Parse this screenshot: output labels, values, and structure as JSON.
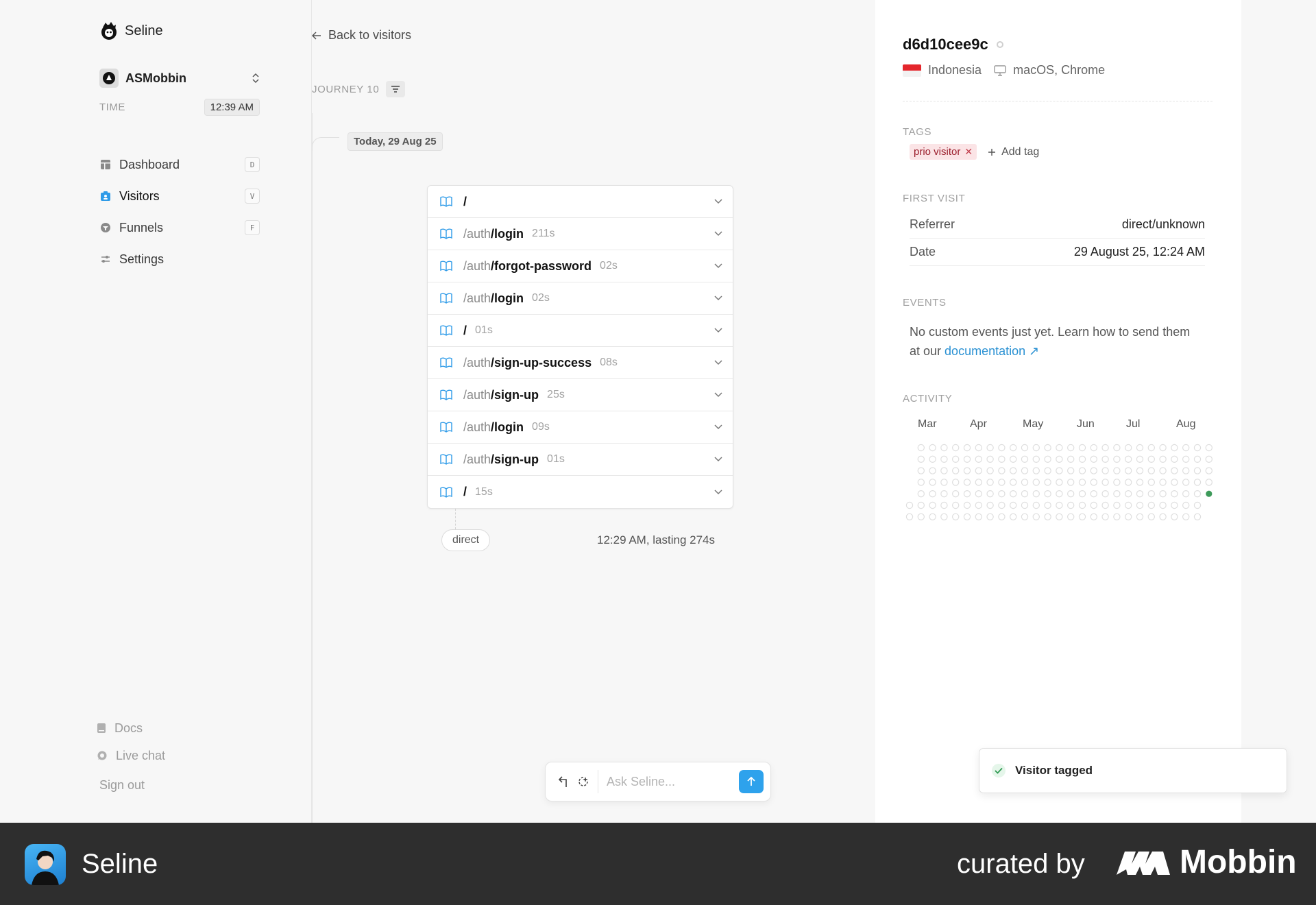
{
  "sidebar": {
    "brand": "Seline",
    "project": "ASMobbin",
    "time_label": "TIME",
    "time_value": "12:39 AM",
    "nav": [
      {
        "label": "Dashboard",
        "key": "D",
        "icon": "layout-icon"
      },
      {
        "label": "Visitors",
        "key": "V",
        "icon": "visitors-icon"
      },
      {
        "label": "Funnels",
        "key": "F",
        "icon": "funnel-icon"
      },
      {
        "label": "Settings",
        "key": "",
        "icon": "sliders-icon"
      }
    ],
    "docs": "Docs",
    "live_chat": "Live chat",
    "sign_out": "Sign out"
  },
  "main": {
    "back": "Back to visitors",
    "journey": "JOURNEY 10",
    "date": "Today, 29 Aug 25",
    "pages": [
      {
        "prefix": "",
        "path": "/",
        "duration": ""
      },
      {
        "prefix": "/auth",
        "path": "/login",
        "duration": "211s"
      },
      {
        "prefix": "/auth",
        "path": "/forgot-password",
        "duration": "02s"
      },
      {
        "prefix": "/auth",
        "path": "/login",
        "duration": "02s"
      },
      {
        "prefix": "",
        "path": "/",
        "duration": "01s"
      },
      {
        "prefix": "/auth",
        "path": "/sign-up-success",
        "duration": "08s"
      },
      {
        "prefix": "/auth",
        "path": "/sign-up",
        "duration": "25s"
      },
      {
        "prefix": "/auth",
        "path": "/login",
        "duration": "09s"
      },
      {
        "prefix": "/auth",
        "path": "/sign-up",
        "duration": "01s"
      },
      {
        "prefix": "",
        "path": "/",
        "duration": "15s"
      }
    ],
    "source": "direct",
    "session": "12:29 AM, lasting 274s",
    "ask_placeholder": "Ask Seline..."
  },
  "panel": {
    "visitor_id": "d6d10cee9c",
    "country": "Indonesia",
    "device": "macOS, Chrome",
    "tags_label": "TAGS",
    "tag": "prio visitor",
    "add_tag": "Add tag",
    "first_visit_label": "FIRST VISIT",
    "first_visit": [
      {
        "key": "Referrer",
        "value": "direct/unknown"
      },
      {
        "key": "Date",
        "value": "29 August 25, 12:24 AM"
      }
    ],
    "events_label": "EVENTS",
    "events_text": "No custom events just yet. Learn how to send them at our",
    "events_link": "documentation",
    "activity_label": "ACTIVITY",
    "months": [
      "Mar",
      "Apr",
      "May",
      "Jun",
      "Jul",
      "Aug"
    ],
    "active_days": 1,
    "active_color": "#3d9a5a"
  },
  "toast": {
    "message": "Visitor tagged"
  },
  "footer": {
    "app_name": "Seline",
    "curated": "curated by",
    "brand": "Mobbin"
  }
}
